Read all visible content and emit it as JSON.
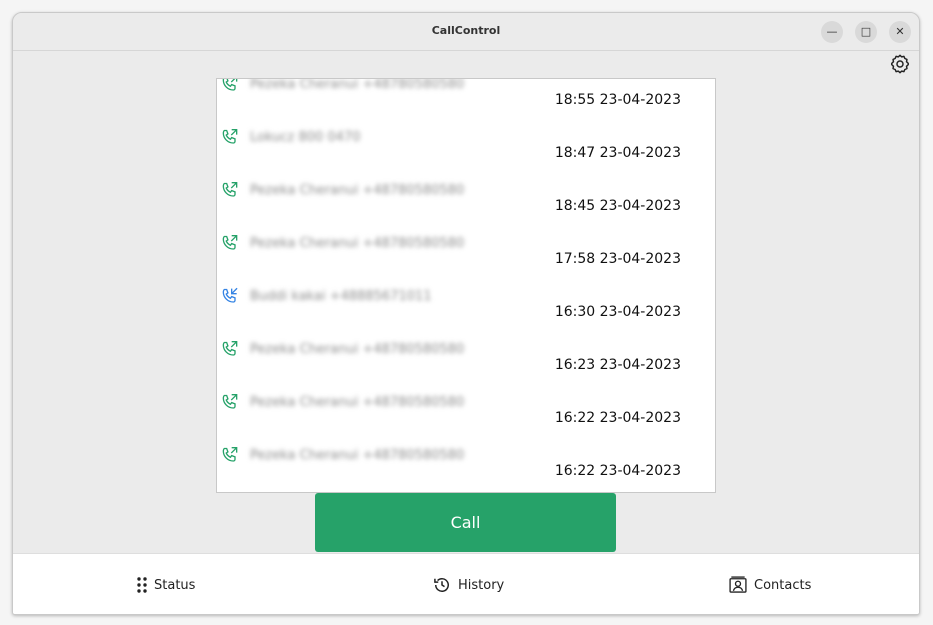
{
  "window": {
    "title": "CallControl",
    "controls": [
      "minimize",
      "maximize",
      "close"
    ]
  },
  "settings": {
    "icon": "gear-icon"
  },
  "history": {
    "entries": [
      {
        "direction": "outgoing",
        "icon": "outgoing-call-icon",
        "name": "Pezeka Cheranui +48780580580",
        "time": "18:55 23-04-2023",
        "color": "#26a269"
      },
      {
        "direction": "outgoing",
        "icon": "outgoing-call-icon",
        "name": "Lokucz 800 0470",
        "time": "18:47 23-04-2023",
        "color": "#26a269"
      },
      {
        "direction": "outgoing",
        "icon": "outgoing-call-icon",
        "name": "Pezeka Cheranui +48780580580",
        "time": "18:45 23-04-2023",
        "color": "#26a269"
      },
      {
        "direction": "outgoing",
        "icon": "outgoing-call-icon",
        "name": "Pezeka Cheranui +48780580580",
        "time": "17:58 23-04-2023",
        "color": "#26a269"
      },
      {
        "direction": "incoming",
        "icon": "incoming-call-icon",
        "name": "Buddi kakai +48885671011",
        "time": "16:30 23-04-2023",
        "color": "#3584e4"
      },
      {
        "direction": "outgoing",
        "icon": "outgoing-call-icon",
        "name": "Pezeka Cheranui +48780580580",
        "time": "16:23 23-04-2023",
        "color": "#26a269"
      },
      {
        "direction": "outgoing",
        "icon": "outgoing-call-icon",
        "name": "Pezeka Cheranui +48780580580",
        "time": "16:22 23-04-2023",
        "color": "#26a269"
      },
      {
        "direction": "outgoing",
        "icon": "outgoing-call-icon",
        "name": "Pezeka Cheranui +48780580580",
        "time": "16:22 23-04-2023",
        "color": "#26a269"
      }
    ]
  },
  "call_button": {
    "label": "Call",
    "color": "#26a269"
  },
  "bottom_nav": {
    "status": {
      "label": "Status",
      "icon": "dots-grid-icon"
    },
    "history": {
      "label": "History",
      "icon": "history-clock-icon"
    },
    "contacts": {
      "label": "Contacts",
      "icon": "contact-card-icon"
    }
  }
}
